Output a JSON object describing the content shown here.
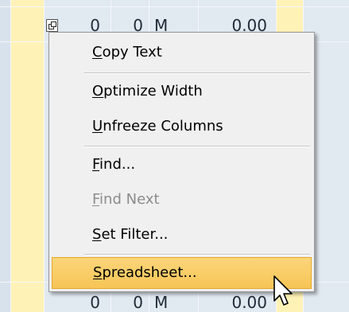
{
  "grid": {
    "top_row": {
      "c1": "0",
      "c2": "0",
      "c3": "M",
      "c4": "0.00"
    },
    "bottom_row": {
      "c1": "0",
      "c2": "0",
      "c3": "M",
      "c4": "0.00"
    }
  },
  "menu": {
    "items": [
      {
        "label": "Copy Text",
        "mnemonic": "C",
        "rest": "opy Text",
        "enabled": true
      },
      {
        "label": "Optimize Width",
        "mnemonic": "O",
        "rest": "ptimize Width",
        "enabled": true
      },
      {
        "label": "Unfreeze Columns",
        "mnemonic": "U",
        "rest": "nfreeze Columns",
        "enabled": true
      },
      {
        "label": "Find...",
        "mnemonic": "F",
        "rest": "ind...",
        "enabled": true
      },
      {
        "label": "Find Next",
        "mnemonic": "F",
        "rest": "ind Next",
        "enabled": false
      },
      {
        "label": "Set Filter...",
        "mnemonic": "S",
        "rest": "et Filter...",
        "enabled": true
      },
      {
        "label": "Spreadsheet...",
        "mnemonic": "S",
        "rest": "preadsheet...",
        "enabled": true,
        "highlighted": true
      }
    ]
  },
  "colors": {
    "grid_background": "#e1e9f1",
    "highlight_column": "#fff4b8",
    "menu_background": "#f0f0f0",
    "highlight_gradient_top": "#fbd57a",
    "highlight_border": "#e5a92e"
  },
  "icons": {
    "row_details": "row-details-icon",
    "pointer": "mouse-pointer-icon"
  }
}
